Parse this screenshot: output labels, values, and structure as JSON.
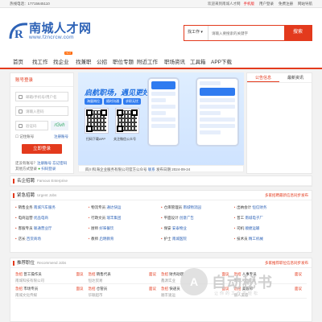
{
  "topbar": {
    "phone": "热线电话：17715645110",
    "welcome": "欢迎来到南城人才网",
    "links": [
      "手机版",
      "用户登录",
      "免费注册",
      "网站导航"
    ]
  },
  "logo": {
    "name": "南城人才网",
    "url": "www.fzncrcw.com",
    "mark": "R"
  },
  "search": {
    "type": "找工作",
    "placeholder": "请输入要搜索的关键字",
    "button": "搜索"
  },
  "nav": {
    "items": [
      "首页",
      "找工作",
      "找企业",
      "找兼职",
      "公招",
      "职位专题",
      "附近工作",
      "职场资讯",
      "工具箱",
      "APP下载"
    ],
    "hot_badge": "HOT"
  },
  "login": {
    "tab": "账号登录",
    "username_placeholder": "邮箱/手机号/用户名",
    "password_placeholder": "请输入密码",
    "captcha_placeholder": "验证码",
    "captcha_code": "rGvh",
    "remember": "记住账号",
    "register": "注册账号",
    "login_button": "立即登录",
    "quick_label": "还没有账号？",
    "quick_links": "注册账号 忘记密码",
    "other_label": "其他方式登录",
    "wx_label": "扫码登录"
  },
  "banner": {
    "title": "启航职场，遇见更好的自己",
    "chips": [
      "海量岗位",
      "随时沟通",
      "求职无忧"
    ],
    "qr1_caption": "扫码下载APP",
    "qr2_caption": "关注微信公众号",
    "company_label": "四川科海企业服务有限公司官方公众号",
    "company_link": "联系",
    "date": "发布日期 2024-09-24"
  },
  "sidepanel": {
    "tabs": [
      "公告信息",
      "最新资讯"
    ]
  },
  "sections": {
    "famous": {
      "title": "名企招聘",
      "en": "Famous Enterprise"
    },
    "urgent": {
      "title": "紧急招聘",
      "en": "Urgent Jobs",
      "more": "多家招聘最新信息同步发布",
      "rows": [
        [
          {
            "job": "销售业务",
            "co": "南城汽车服务"
          },
          {
            "job": "物流专员",
            "co": "通达快运"
          },
          {
            "job": "仓库管理员",
            "co": "南城物流园"
          },
          {
            "job": "出纳会计",
            "co": "恒信财务"
          }
        ],
        [
          {
            "job": "电商运营",
            "co": "优品电商"
          },
          {
            "job": "行政文员",
            "co": "瑞丰集团"
          },
          {
            "job": "平面设计",
            "co": "创意广告"
          },
          {
            "job": "普工",
            "co": "南城电子厂"
          }
        ],
        [
          {
            "job": "客服专员",
            "co": "联通营业厅"
          },
          {
            "job": "厨师",
            "co": "好味餐饮"
          },
          {
            "job": "保安",
            "co": "安泰物业"
          },
          {
            "job": "司机",
            "co": "顺捷运输"
          }
        ],
        [
          {
            "job": "店长",
            "co": "百货商场"
          },
          {
            "job": "教师",
            "co": "启明教育"
          },
          {
            "job": "护士",
            "co": "南城医院"
          },
          {
            "job": "技术员",
            "co": "精工机械"
          }
        ]
      ]
    },
    "recommend": {
      "title": "推荐职位",
      "en": "Recommend Jobs",
      "more": "多家推荐职位信息同步发布",
      "cards": [
        {
          "tag": "急招",
          "job": "普工操作员",
          "salary": "面议",
          "co": "南城科技有限公司"
        },
        {
          "tag": "急招",
          "job": "销售代表",
          "salary": "面议",
          "co": "恒达贸易"
        },
        {
          "tag": "急招",
          "job": "财务助理",
          "salary": "面议",
          "co": "鑫源实业"
        },
        {
          "tag": "急招",
          "job": "人事专员",
          "salary": "面议",
          "co": "南城人力资源"
        },
        {
          "tag": "急招",
          "job": "市场专员",
          "salary": "面议",
          "co": "南城文化传媒"
        },
        {
          "tag": "急招",
          "job": "仓管员",
          "salary": "面议",
          "co": "华联超市"
        },
        {
          "tag": "急招",
          "job": "快递员",
          "salary": "面议",
          "co": "顺丰速运"
        },
        {
          "tag": "急招",
          "job": "美容师",
          "salary": "面议",
          "co": "丽人美容"
        }
      ]
    }
  },
  "watermark": {
    "text": "自动秘书",
    "sub": "让你的工作更轻松",
    "icon": "A"
  }
}
